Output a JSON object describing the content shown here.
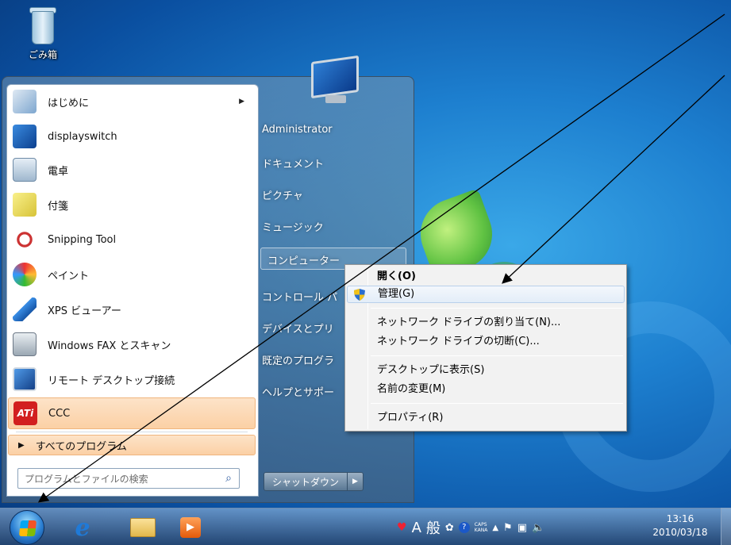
{
  "desktop": {
    "recycle_bin_label": "ごみ箱"
  },
  "start_menu": {
    "programs": [
      {
        "label": "はじめに",
        "icon": "getting-started-icon",
        "has_submenu": true
      },
      {
        "label": "displayswitch",
        "icon": "display-switch-icon"
      },
      {
        "label": "電卓",
        "icon": "calculator-icon"
      },
      {
        "label": "付箋",
        "icon": "sticky-notes-icon"
      },
      {
        "label": "Snipping Tool",
        "icon": "scissors-icon"
      },
      {
        "label": "ペイント",
        "icon": "paint-palette-icon"
      },
      {
        "label": "XPS ビューアー",
        "icon": "xps-viewer-icon"
      },
      {
        "label": "Windows FAX とスキャン",
        "icon": "fax-icon"
      },
      {
        "label": "リモート デスクトップ接続",
        "icon": "remote-desktop-icon"
      },
      {
        "label": "CCC",
        "icon": "ati-logo-icon"
      }
    ],
    "all_programs_label": "すべてのプログラム",
    "search_placeholder": "プログラムとファイルの検索",
    "right_items": [
      "Administrator",
      "ドキュメント",
      "ピクチャ",
      "ミュージック",
      "コンピューター",
      "コントロール パ",
      "デバイスとプリ",
      "既定のプログラ",
      "ヘルプとサポー"
    ],
    "shutdown_label": "シャットダウン"
  },
  "context_menu": {
    "items": [
      {
        "label": "開く(O)",
        "bold": true
      },
      {
        "label": "管理(G)",
        "hover": true,
        "icon": "uac-shield-icon"
      },
      {
        "label": "ネットワーク ドライブの割り当て(N)..."
      },
      {
        "label": "ネットワーク ドライブの切断(C)..."
      },
      {
        "label": "デスクトップに表示(S)"
      },
      {
        "label": "名前の変更(M)"
      },
      {
        "label": "プロパティ(R)"
      }
    ]
  },
  "taskbar": {
    "ime_mode": "A",
    "ime_kanji": "般",
    "caps_label": "CAPS",
    "kana_label": "KANA",
    "clock_time": "13:16",
    "clock_date": "2010/03/18"
  },
  "colors": {
    "menu_highlight": "#fbd0a5",
    "ctx_hover": "#e3edf8",
    "desktop_blue": "#1d7fcf"
  }
}
